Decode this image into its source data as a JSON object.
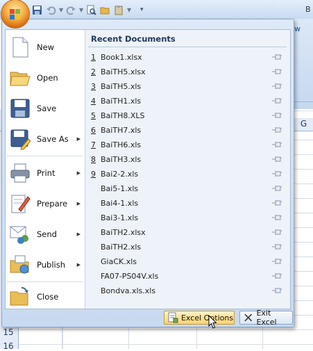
{
  "window": {
    "title_tail": "B"
  },
  "ribbon": {
    "tab_partial": "w"
  },
  "grid": {
    "column_label": "G",
    "row_numbers": [
      "15",
      "16"
    ]
  },
  "menu": {
    "items": [
      {
        "label": "New",
        "has_submenu": false,
        "icon": "new-document-icon"
      },
      {
        "label": "Open",
        "has_submenu": false,
        "icon": "open-folder-icon"
      },
      {
        "label": "Save",
        "has_submenu": false,
        "icon": "save-disk-icon"
      },
      {
        "label": "Save As",
        "has_submenu": true,
        "icon": "save-as-icon"
      },
      {
        "label": "Print",
        "has_submenu": true,
        "icon": "printer-icon"
      },
      {
        "label": "Prepare",
        "has_submenu": true,
        "icon": "prepare-icon"
      },
      {
        "label": "Send",
        "has_submenu": true,
        "icon": "send-icon"
      },
      {
        "label": "Publish",
        "has_submenu": true,
        "icon": "publish-icon"
      },
      {
        "label": "Close",
        "has_submenu": false,
        "icon": "close-folder-icon"
      }
    ],
    "recent": {
      "title": "Recent Documents",
      "documents": [
        {
          "num": "1",
          "name": "Book1.xlsx"
        },
        {
          "num": "2",
          "name": "BaiTH5.xlsx"
        },
        {
          "num": "3",
          "name": "BaiTH5.xls"
        },
        {
          "num": "4",
          "name": "BaiTH1.xls"
        },
        {
          "num": "5",
          "name": "BaiTH8.XLS"
        },
        {
          "num": "6",
          "name": "BaiTH7.xls"
        },
        {
          "num": "7",
          "name": "BaiTH6.xls"
        },
        {
          "num": "8",
          "name": "BaiTH3.xls"
        },
        {
          "num": "9",
          "name": "Bai2-2.xls"
        },
        {
          "num": "",
          "name": "Bai5-1.xls"
        },
        {
          "num": "",
          "name": "Bai4-1.xls"
        },
        {
          "num": "",
          "name": "Bai3-1.xls"
        },
        {
          "num": "",
          "name": "BaiTH2.xlsx"
        },
        {
          "num": "",
          "name": "BaiTH2.xls"
        },
        {
          "num": "",
          "name": "GiaCK.xls"
        },
        {
          "num": "",
          "name": "FA07-PS04V.xls"
        },
        {
          "num": "",
          "name": "Bondva.xls.xls"
        }
      ]
    },
    "buttons": {
      "options": "Excel Options",
      "exit": "Exit Excel"
    }
  },
  "colors": {
    "accent": "#1e395b",
    "menu_bg": "#dde9f8",
    "options_hover": "#ffd26a"
  }
}
